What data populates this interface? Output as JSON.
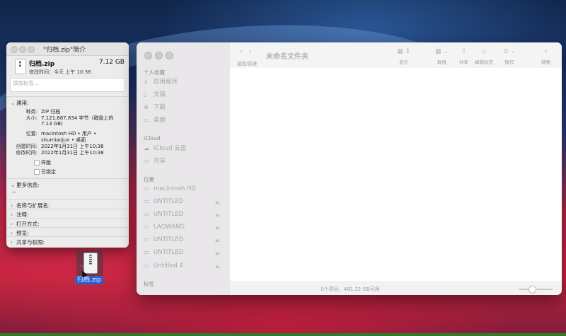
{
  "info_window": {
    "title": "\"归档.zip\"简介",
    "file_name": "归档.zip",
    "file_size": "7.12 GB",
    "modified_line": "修改时间：今天 上午 10:38",
    "tags_placeholder": "添加标签...",
    "general": {
      "header": "通用:",
      "kind_label": "种类:",
      "kind_value": "ZIP 归档",
      "size_label": "大小:",
      "size_value_1": "7,121,687,834 字节（磁盘上的",
      "size_value_2": "7.13 GB)",
      "where_label": "位置:",
      "where_value_1": "macintosh HD • 用户 •",
      "where_value_2": "shumiaojun • 桌面",
      "created_label": "创建时间:",
      "created_value": "2022年1月31日 上午10:36",
      "modified_label": "修改时间:",
      "modified_value": "2022年1月31日 上午10:38",
      "stationery": "样版",
      "locked": "已锁定"
    },
    "more_info": {
      "header": "更多信息:",
      "value": "--"
    },
    "sections": [
      "名称与扩展名:",
      "注释:",
      "打开方式:",
      "预览:",
      "共享与权限:"
    ]
  },
  "finder": {
    "title": "未命名文件夹",
    "nav_label": "返回/前进",
    "toolbar": {
      "view": "显示",
      "group": "群组",
      "share": "共享",
      "tags": "编辑标签",
      "action": "操作",
      "search": "搜索"
    },
    "sidebar": {
      "favorites_header": "个人收藏",
      "favorites": [
        "应用程序",
        "文稿",
        "下载",
        "桌面"
      ],
      "icloud_header": "iCloud",
      "icloud": [
        "iCloud 云盘",
        "共享"
      ],
      "locations_header": "位置",
      "locations": [
        "macintosh HD",
        "UNTITLED",
        "UNTITLED",
        "LAOWANG",
        "UNTITLED",
        "UNTITLED",
        "Untitled 4"
      ],
      "tags_header": "标签"
    },
    "status": "0个项目，481.22 GB可用"
  },
  "desktop": {
    "icon_label": "归档.zip",
    "icon_tag": "ZIP"
  }
}
